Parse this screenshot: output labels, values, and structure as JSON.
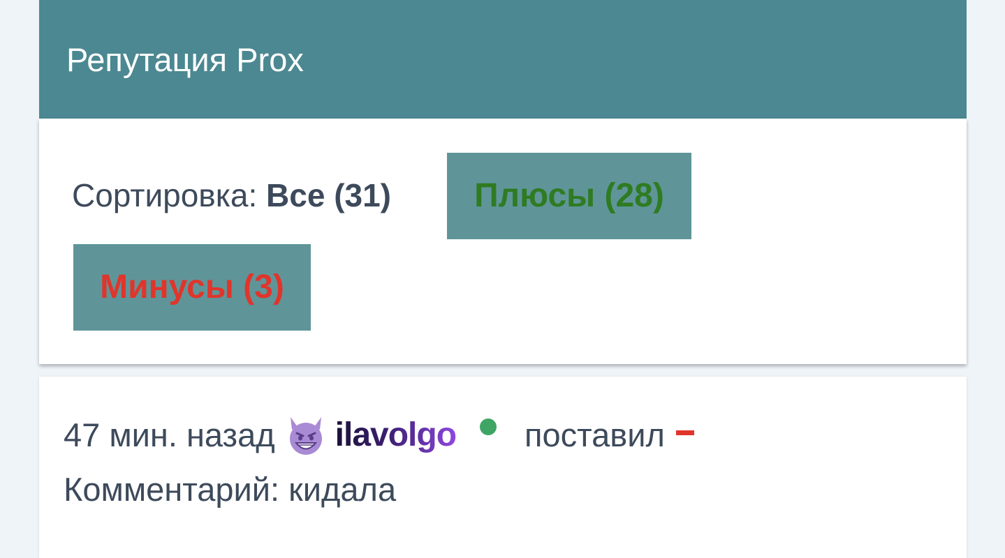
{
  "header": {
    "title": "Репутация Prox"
  },
  "sort": {
    "label": "Сортировка: ",
    "all_label": "Все (31)",
    "plus_label": "Плюсы (28)",
    "minus_label": "Минусы (3)"
  },
  "entries": [
    {
      "time": "47 мин. назад",
      "avatar_icon": "smiling-devil-emoji-icon",
      "username": "ilavolgo",
      "online_status_icon": "online-dot-icon",
      "action": "поставил",
      "vote_icon": "minus-mark-icon",
      "comment": "Комментарий: кидала"
    }
  ],
  "colors": {
    "header_bg": "#4c8891",
    "button_bg": "#5f9599",
    "plus": "#2f7b22",
    "minus": "#e0352b",
    "online": "#3ea565",
    "text": "#3d4a5b"
  }
}
